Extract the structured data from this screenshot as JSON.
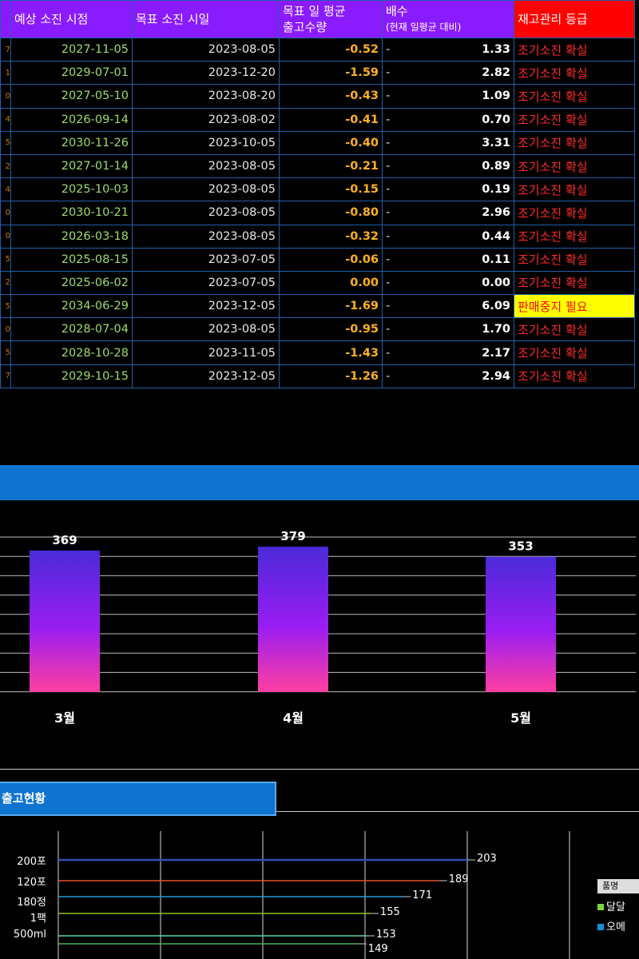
{
  "table": {
    "headers": {
      "expected": "예상 소진 시점",
      "target": "목표 소진 시일",
      "avg_line1": "목표 일 평균",
      "avg_line2": "출고수량",
      "ratio_line1": "배수",
      "ratio_line2": "(현재 일평균 대비)",
      "grade": "재고관리 등급"
    },
    "rows": [
      {
        "edge": "7",
        "expected": "2027-11-05",
        "target": "2023-08-05",
        "avg": "-0.52",
        "dash": "-",
        "ratio": "1.33",
        "grade": "조기소진 확실",
        "stop": false
      },
      {
        "edge": "1",
        "expected": "2029-07-01",
        "target": "2023-12-20",
        "avg": "-1.59",
        "dash": "-",
        "ratio": "2.82",
        "grade": "조기소진 확실",
        "stop": false
      },
      {
        "edge": "0",
        "expected": "2027-05-10",
        "target": "2023-08-20",
        "avg": "-0.43",
        "dash": "-",
        "ratio": "1.09",
        "grade": "조기소진 확실",
        "stop": false
      },
      {
        "edge": "4",
        "expected": "2026-09-14",
        "target": "2023-08-02",
        "avg": "-0.41",
        "dash": "-",
        "ratio": "0.70",
        "grade": "조기소진 확실",
        "stop": false
      },
      {
        "edge": "5",
        "expected": "2030-11-26",
        "target": "2023-10-05",
        "avg": "-0.40",
        "dash": "-",
        "ratio": "3.31",
        "grade": "조기소진 확실",
        "stop": false
      },
      {
        "edge": "2",
        "expected": "2027-01-14",
        "target": "2023-08-05",
        "avg": "-0.21",
        "dash": "-",
        "ratio": "0.89",
        "grade": "조기소진 확실",
        "stop": false
      },
      {
        "edge": "4",
        "expected": "2025-10-03",
        "target": "2023-08-05",
        "avg": "-0.15",
        "dash": "-",
        "ratio": "0.19",
        "grade": "조기소진 확실",
        "stop": false
      },
      {
        "edge": "0",
        "expected": "2030-10-21",
        "target": "2023-08-05",
        "avg": "-0.80",
        "dash": "-",
        "ratio": "2.96",
        "grade": "조기소진 확실",
        "stop": false
      },
      {
        "edge": "0",
        "expected": "2026-03-18",
        "target": "2023-08-05",
        "avg": "-0.32",
        "dash": "-",
        "ratio": "0.44",
        "grade": "조기소진 확실",
        "stop": false
      },
      {
        "edge": "5",
        "expected": "2025-08-15",
        "target": "2023-07-05",
        "avg": "-0.06",
        "dash": "-",
        "ratio": "0.11",
        "grade": "조기소진 확실",
        "stop": false
      },
      {
        "edge": "2",
        "expected": "2025-06-02",
        "target": "2023-07-05",
        "avg": "0.00",
        "dash": "-",
        "ratio": "0.00",
        "grade": "조기소진 확실",
        "stop": false
      },
      {
        "edge": "5",
        "expected": "2034-06-29",
        "target": "2023-12-05",
        "avg": "-1.69",
        "dash": "-",
        "ratio": "6.09",
        "grade": "판매중지 필요",
        "stop": true
      },
      {
        "edge": "0",
        "expected": "2028-07-04",
        "target": "2023-08-05",
        "avg": "-0.95",
        "dash": "-",
        "ratio": "1.70",
        "grade": "조기소진 확실",
        "stop": false
      },
      {
        "edge": "5",
        "expected": "2028-10-28",
        "target": "2023-11-05",
        "avg": "-1.43",
        "dash": "-",
        "ratio": "2.17",
        "grade": "조기소진 확실",
        "stop": false
      },
      {
        "edge": "7",
        "expected": "2029-10-15",
        "target": "2023-12-05",
        "avg": "-1.26",
        "dash": "-",
        "ratio": "2.94",
        "grade": "조기소진 확실",
        "stop": false
      }
    ]
  },
  "colors": {
    "header_bg": "#8a1bff",
    "grade_header_bg": "#ff0000",
    "banner": "#0e74d0",
    "bar_top": "#4a2ad8",
    "bar_mid": "#9a1df2",
    "bar_bottom": "#ff3fa0"
  },
  "bar_section": {
    "chart_data": {
      "type": "bar",
      "categories": [
        "3월",
        "4월",
        "5월"
      ],
      "values": [
        369,
        379,
        353
      ],
      "data_labels": [
        "369",
        "379",
        "353"
      ],
      "grid": true
    }
  },
  "line_section": {
    "title": "출고현황",
    "y_labels": [
      "200포",
      "120포",
      "180정",
      "1팩",
      "500ml"
    ],
    "chart_data": {
      "type": "line",
      "series": [
        {
          "value": 203,
          "label": "203",
          "color": "#2f4fb8"
        },
        {
          "value": 189,
          "label": "189",
          "color": "#e8502a"
        },
        {
          "value": 171,
          "label": "171",
          "color": "#1aa0d8"
        },
        {
          "value": 155,
          "label": "155",
          "color": "#8fc31f"
        },
        {
          "value": 153,
          "label": "153",
          "color": "#58d6a8"
        },
        {
          "value": 149,
          "label": "149",
          "color": "#4caf50"
        }
      ]
    },
    "legend": {
      "header": "품명",
      "items": [
        {
          "label": "달달",
          "color": "#7ad63a"
        },
        {
          "label": "오메",
          "color": "#1a8fd8"
        }
      ]
    }
  }
}
